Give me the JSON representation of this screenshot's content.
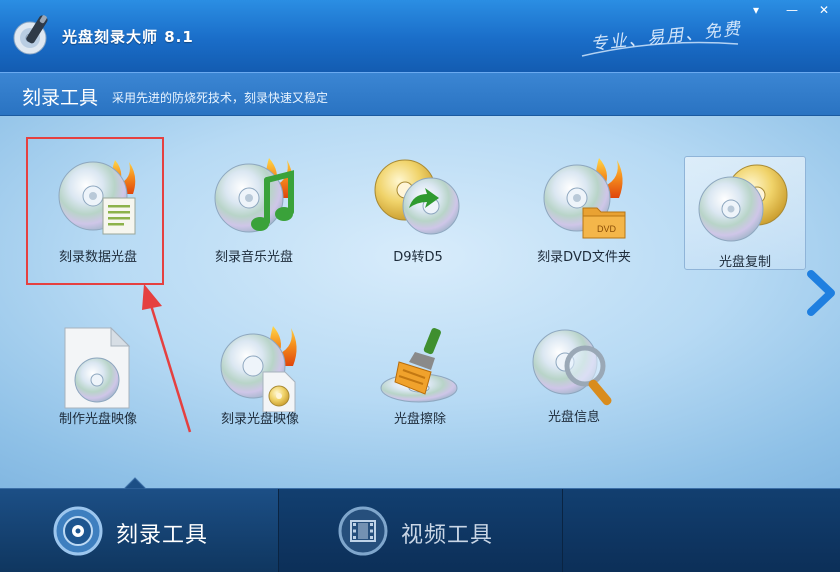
{
  "app": {
    "title": "光盘刻录大师 8.1",
    "slogan": "专业、易用、免费",
    "window_controls": {
      "menu": "▾",
      "minimize": "—",
      "close": "✕"
    }
  },
  "section": {
    "title": "刻录工具",
    "description": "采用先进的防烧死技术，刻录快速又稳定"
  },
  "tools": [
    {
      "label": "刻录数据光盘",
      "icon": "burn-data-disc-icon"
    },
    {
      "label": "刻录音乐光盘",
      "icon": "burn-music-disc-icon"
    },
    {
      "label": "D9转D5",
      "icon": "d9-to-d5-icon"
    },
    {
      "label": "刻录DVD文件夹",
      "icon": "burn-dvd-folder-icon"
    },
    {
      "label": "光盘复制",
      "icon": "disc-copy-icon"
    },
    {
      "label": "制作光盘映像",
      "icon": "make-disc-image-icon"
    },
    {
      "label": "刻录光盘映像",
      "icon": "burn-disc-image-icon"
    },
    {
      "label": "光盘擦除",
      "icon": "disc-erase-icon"
    },
    {
      "label": "光盘信息",
      "icon": "disc-info-icon"
    }
  ],
  "tabs": [
    {
      "label": "刻录工具",
      "active": true,
      "icon": "disc-icon"
    },
    {
      "label": "视频工具",
      "active": false,
      "icon": "film-icon"
    }
  ],
  "colors": {
    "highlight": "#e54040",
    "accent": "#1a6dc8",
    "next_arrow": "#1f7fe0"
  }
}
